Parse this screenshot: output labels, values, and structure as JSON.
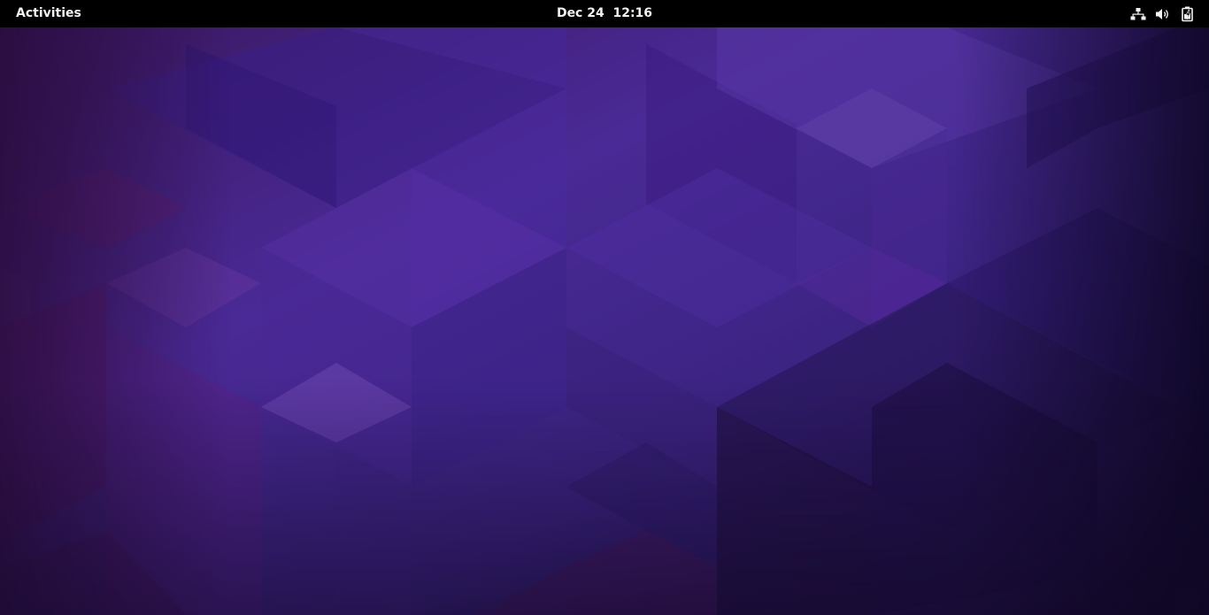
{
  "top_bar": {
    "activities_label": "Activities",
    "clock": {
      "date": "Dec 24",
      "time": "12:16"
    },
    "tray_icons": [
      "network-wired-icon",
      "volume-icon",
      "battery-charging-icon"
    ]
  },
  "colors": {
    "panel_bg": "#000000",
    "panel_text": "#f2f2f2",
    "wallpaper_deep": "#1c0f3a",
    "wallpaper_mid": "#4a2a92",
    "wallpaper_magenta": "#5a1f6e"
  }
}
